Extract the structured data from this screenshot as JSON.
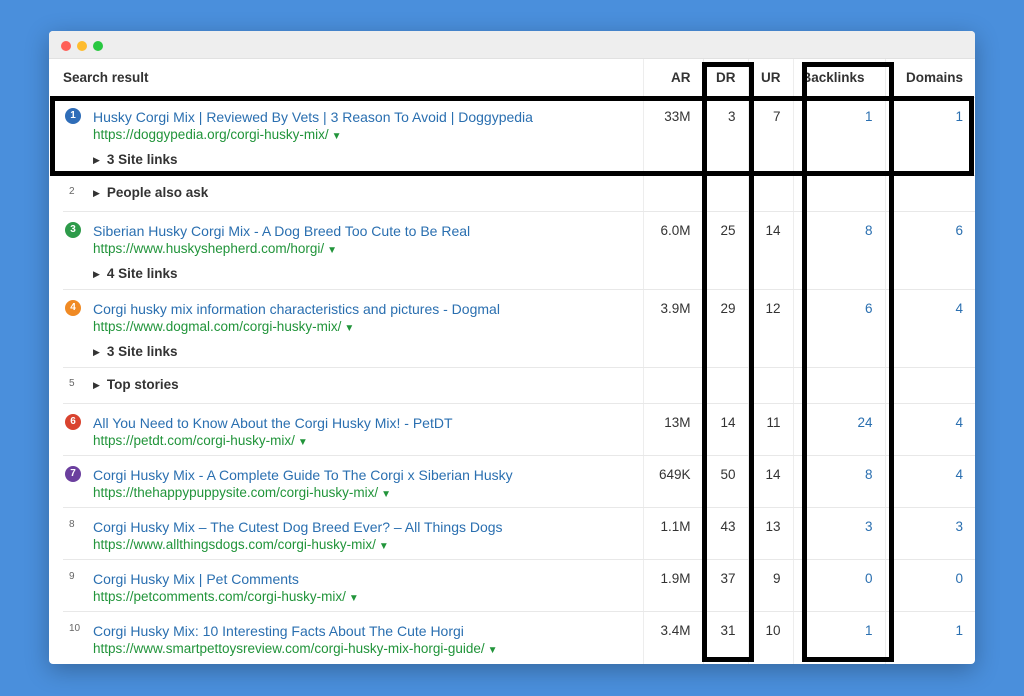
{
  "window": {
    "controls": [
      "close",
      "minimize",
      "maximize"
    ]
  },
  "headers": {
    "result": "Search result",
    "ar": "AR",
    "dr": "DR",
    "ur": "UR",
    "backlinks": "Backlinks",
    "domains": "Domains"
  },
  "rows": [
    {
      "pos": "1",
      "pos_color": "#2f6db8",
      "title": "Husky Corgi Mix | Reviewed By Vets | 3 Reason To Avoid | Doggypedia",
      "url": "https://doggypedia.org/corgi-husky-mix/",
      "caret": "▼",
      "sitelinks": "3 Site links",
      "ar": "33M",
      "dr": "3",
      "ur": "7",
      "backlinks": "1",
      "domains": "1"
    },
    {
      "pos": "2",
      "feature": "People also ask"
    },
    {
      "pos": "3",
      "pos_color": "#2e9b4a",
      "title": "Siberian Husky Corgi Mix - A Dog Breed Too Cute to Be Real",
      "url": "https://www.huskyshepherd.com/horgi/",
      "caret": "▼",
      "sitelinks": "4 Site links",
      "ar": "6.0M",
      "dr": "25",
      "ur": "14",
      "backlinks": "8",
      "domains": "6"
    },
    {
      "pos": "4",
      "pos_color": "#f08a24",
      "title": "Corgi husky mix information characteristics and pictures - Dogmal",
      "url": "https://www.dogmal.com/corgi-husky-mix/",
      "caret": "▼",
      "sitelinks": "3 Site links",
      "ar": "3.9M",
      "dr": "29",
      "ur": "12",
      "backlinks": "6",
      "domains": "4"
    },
    {
      "pos": "5",
      "feature": "Top stories"
    },
    {
      "pos": "6",
      "pos_color": "#d9432f",
      "title": "All You Need to Know About the Corgi Husky Mix! - PetDT",
      "url": "https://petdt.com/corgi-husky-mix/",
      "caret": "▼",
      "ar": "13M",
      "dr": "14",
      "ur": "11",
      "backlinks": "24",
      "domains": "4"
    },
    {
      "pos": "7",
      "pos_color": "#6b3f9e",
      "title": "Corgi Husky Mix - A Complete Guide To The Corgi x Siberian Husky",
      "url": "https://thehappypuppysite.com/corgi-husky-mix/",
      "caret": "▼",
      "ar": "649K",
      "dr": "50",
      "ur": "14",
      "backlinks": "8",
      "domains": "4"
    },
    {
      "pos": "8",
      "title": "Corgi Husky Mix – The Cutest Dog Breed Ever? – All Things Dogs",
      "url": "https://www.allthingsdogs.com/corgi-husky-mix/",
      "caret": "▼",
      "ar": "1.1M",
      "dr": "43",
      "ur": "13",
      "backlinks": "3",
      "domains": "3"
    },
    {
      "pos": "9",
      "title": "Corgi Husky Mix | Pet Comments",
      "url": "https://petcomments.com/corgi-husky-mix/",
      "caret": "▼",
      "ar": "1.9M",
      "dr": "37",
      "ur": "9",
      "backlinks": "0",
      "domains": "0"
    },
    {
      "pos": "10",
      "title": "Corgi Husky Mix: 10 Interesting Facts About The Cute Horgi",
      "url": "https://www.smartpettoysreview.com/corgi-husky-mix-horgi-guide/",
      "caret": "▼",
      "ar": "3.4M",
      "dr": "31",
      "ur": "10",
      "backlinks": "1",
      "domains": "1"
    }
  ],
  "colors": {
    "background": "#4a8fdc",
    "link": "#2a6fb0",
    "url": "#21943a",
    "highlight": "#000000"
  }
}
